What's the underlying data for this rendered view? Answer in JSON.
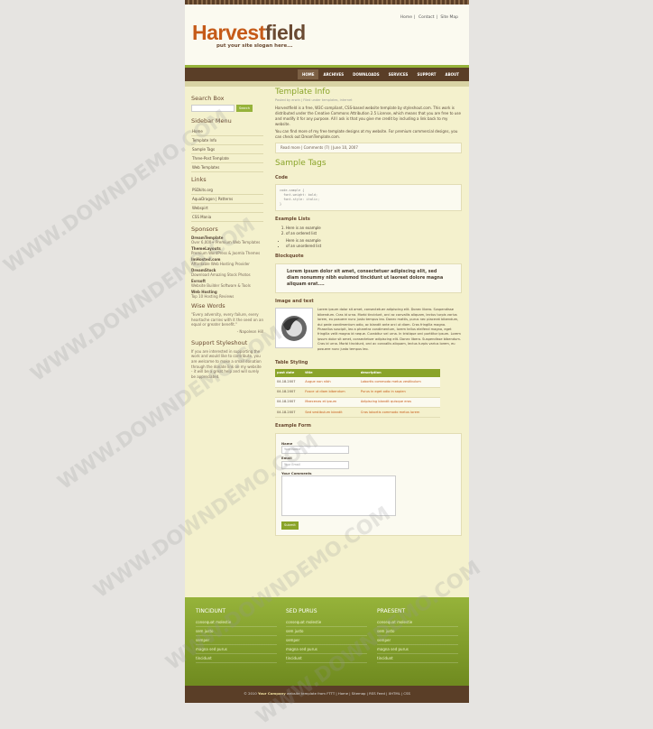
{
  "header": {
    "toplinks": [
      "Home",
      "Contact",
      "Site Map"
    ],
    "logo_a": "Harvest",
    "logo_b": "field",
    "slogan": "put your site slogan here..."
  },
  "nav": [
    "HOME",
    "ARCHIVES",
    "DOWNLOADS",
    "SERVICES",
    "SUPPORT",
    "ABOUT"
  ],
  "sidebar": {
    "search_title": "Search Box",
    "search_button": "Search",
    "menu_title": "Sidebar Menu",
    "menu": [
      "Home",
      "Template Info",
      "Sample Tags",
      "Three-Post Template",
      "Web Templates"
    ],
    "links_title": "Links",
    "links": [
      "PSDkits.org",
      "AquaDragon | Patterns",
      "Webspirt",
      "CSS Mania"
    ],
    "sponsors_title": "Sponsors",
    "sponsors": [
      {
        "name": "DreamTemplate",
        "desc": "Over 6,000+ Premium Web Templates"
      },
      {
        "name": "ThemeLayouts",
        "desc": "Premium WordPress & Joomla Themes"
      },
      {
        "name": "ImHosted.com",
        "desc": "Affordable Web Hosting Provider"
      },
      {
        "name": "DreamStock",
        "desc": "Download Amazing Stock Photos"
      },
      {
        "name": "Evrsoft",
        "desc": "Website Builder Software & Tools"
      },
      {
        "name": "Web Hosting",
        "desc": "Top 10 Hosting Reviews"
      }
    ],
    "wise_title": "Wise Words",
    "quote": "\"Every adversity, every failure, every heartache carries with it the seed on an equal or greater benefit.\"",
    "quote_author": "- Napoleon Hill",
    "support_title": "Support Styleshout",
    "support_text": "If you are interested in supporting the work and would like to contribute, you are welcome to make a small donation through the donate link on my website - it will be a great help and will surely be appreciated."
  },
  "main": {
    "title1": "Template Info",
    "meta1": "Posted by erwin | Filed under templates, internet",
    "p1": "Harvestfield is a free, W3C-compliant, CSS-based website template by styleshout.com. This work is distributed under the Creative Commons Attribution 2.5 License, which means that you are free to use and modify it for any purpose. All I ask is that you give me credit by including a link back to my website.",
    "p2": "You can find more of my free template designs at my website. For premium commercial designs, you can check out DreamTemplate.com.",
    "postmeta": "Read more  |  Comments (7)  |  June 10, 2007",
    "title2": "Sample Tags",
    "code_h": "Code",
    "code": "code-sample {\n  font-weight: bold;\n  font-style: italic;\n}",
    "lists_h": "Example Lists",
    "ol": [
      "Here is an example",
      "of an ordered list"
    ],
    "ul": [
      "Here is an example",
      "of an unordered list"
    ],
    "bq_h": "Blockquote",
    "blockquote": "Lorem ipsum dolor sit amet, consectetuer adipiscing elit, sed diam nonummy nibh euismod tincidunt ut laoreet dolore magna aliquam erat....",
    "imgtext_h": "Image and text",
    "imgtext": "Lorem ipsum dolor sit amet, consectetuer adipiscing elit. Donec libero. Suspendisse bibendum. Cras id urna. Morbi tincidunt, orci ac convallis aliquam, lectus turpis varius lorem, eu posuere nunc justo tempus leo. Donec mattis, purus nec placerat bibendum, dui pede condimentum odio, ac blandit ante orci ut diam. Cras fringilla magna. Phasellus suscipit, leo a pharetra condimentum, lorem tellus eleifend magna, eget fringilla velit magna id neque. Curabitur vel urna. In tristique orci porttitor ipsum. Lorem ipsum dolor sit amet, consectetuer adipiscing elit. Donec libero. Suspendisse bibendum. Cras id urna. Morbi tincidunt, orci ac convallis aliquam, lectus turpis varius lorem, eu posuere nunc justo tempus leo.",
    "table_h": "Table Styling",
    "table_cols": [
      "post date",
      "title",
      "description"
    ],
    "table_rows": [
      [
        "04.18.2007",
        "Augue non nibh",
        "Lobortis commodo metus vestibulum"
      ],
      [
        "04.18.2007",
        "Fusce ut diam bibendum",
        "Purus in eget odio in sapien"
      ],
      [
        "04.18.2007",
        "Maecenas et ipsum",
        "Adipiscing blandit quisque eros"
      ],
      [
        "04.18.2007",
        "Sed vestibulum blandit",
        "Cras lobortis commodo metus lorem"
      ]
    ],
    "form_h": "Example Form",
    "form_name": "Name",
    "form_name_ph": "Your Name",
    "form_email": "Email",
    "form_email_ph": "Your Email",
    "form_comments": "Your Comments",
    "form_submit": "Submit"
  },
  "footer": {
    "cols": [
      {
        "title": "TINCIDUNT",
        "links": [
          "consequat molestie",
          "sem justo",
          "semper",
          "magna sed purus",
          "tincidunt"
        ]
      },
      {
        "title": "SED PURUS",
        "links": [
          "consequat molestie",
          "sem justo",
          "semper",
          "magna sed purus",
          "tincidunt"
        ]
      },
      {
        "title": "PRAESENT",
        "links": [
          "consequat molestie",
          "sem justo",
          "semper",
          "magna sed purus",
          "tincidunt"
        ]
      }
    ],
    "copyright_a": "© 2010 ",
    "copyright_company": "Your Company",
    "copyright_b": "   website template from FTTT   |  Home  |  Sitemap  |  RSS Feed  |  XHTML  |  CSS"
  },
  "watermark": "WWW.DOWNDEMO.COM"
}
